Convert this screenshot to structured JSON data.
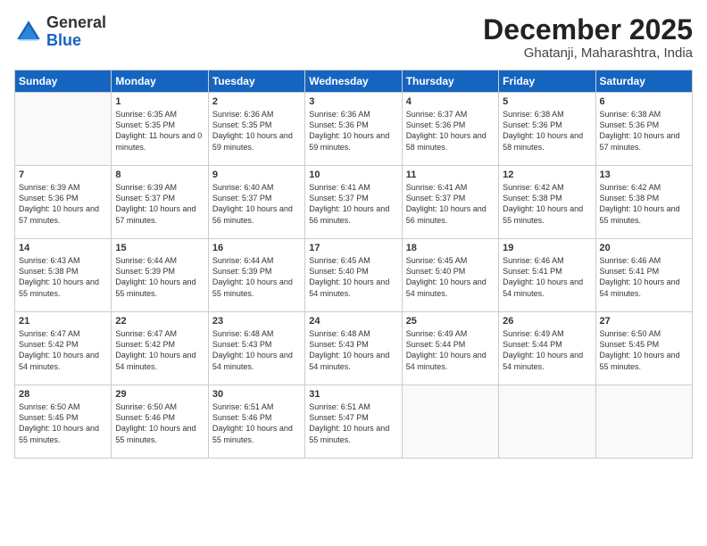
{
  "header": {
    "logo_line1": "General",
    "logo_line2": "Blue",
    "month": "December 2025",
    "location": "Ghatanji, Maharashtra, India"
  },
  "weekdays": [
    "Sunday",
    "Monday",
    "Tuesday",
    "Wednesday",
    "Thursday",
    "Friday",
    "Saturday"
  ],
  "weeks": [
    [
      {
        "day": "",
        "sunrise": "",
        "sunset": "",
        "daylight": ""
      },
      {
        "day": "1",
        "sunrise": "Sunrise: 6:35 AM",
        "sunset": "Sunset: 5:35 PM",
        "daylight": "Daylight: 11 hours and 0 minutes."
      },
      {
        "day": "2",
        "sunrise": "Sunrise: 6:36 AM",
        "sunset": "Sunset: 5:35 PM",
        "daylight": "Daylight: 10 hours and 59 minutes."
      },
      {
        "day": "3",
        "sunrise": "Sunrise: 6:36 AM",
        "sunset": "Sunset: 5:36 PM",
        "daylight": "Daylight: 10 hours and 59 minutes."
      },
      {
        "day": "4",
        "sunrise": "Sunrise: 6:37 AM",
        "sunset": "Sunset: 5:36 PM",
        "daylight": "Daylight: 10 hours and 58 minutes."
      },
      {
        "day": "5",
        "sunrise": "Sunrise: 6:38 AM",
        "sunset": "Sunset: 5:36 PM",
        "daylight": "Daylight: 10 hours and 58 minutes."
      },
      {
        "day": "6",
        "sunrise": "Sunrise: 6:38 AM",
        "sunset": "Sunset: 5:36 PM",
        "daylight": "Daylight: 10 hours and 57 minutes."
      }
    ],
    [
      {
        "day": "7",
        "sunrise": "Sunrise: 6:39 AM",
        "sunset": "Sunset: 5:36 PM",
        "daylight": "Daylight: 10 hours and 57 minutes."
      },
      {
        "day": "8",
        "sunrise": "Sunrise: 6:39 AM",
        "sunset": "Sunset: 5:37 PM",
        "daylight": "Daylight: 10 hours and 57 minutes."
      },
      {
        "day": "9",
        "sunrise": "Sunrise: 6:40 AM",
        "sunset": "Sunset: 5:37 PM",
        "daylight": "Daylight: 10 hours and 56 minutes."
      },
      {
        "day": "10",
        "sunrise": "Sunrise: 6:41 AM",
        "sunset": "Sunset: 5:37 PM",
        "daylight": "Daylight: 10 hours and 56 minutes."
      },
      {
        "day": "11",
        "sunrise": "Sunrise: 6:41 AM",
        "sunset": "Sunset: 5:37 PM",
        "daylight": "Daylight: 10 hours and 56 minutes."
      },
      {
        "day": "12",
        "sunrise": "Sunrise: 6:42 AM",
        "sunset": "Sunset: 5:38 PM",
        "daylight": "Daylight: 10 hours and 55 minutes."
      },
      {
        "day": "13",
        "sunrise": "Sunrise: 6:42 AM",
        "sunset": "Sunset: 5:38 PM",
        "daylight": "Daylight: 10 hours and 55 minutes."
      }
    ],
    [
      {
        "day": "14",
        "sunrise": "Sunrise: 6:43 AM",
        "sunset": "Sunset: 5:38 PM",
        "daylight": "Daylight: 10 hours and 55 minutes."
      },
      {
        "day": "15",
        "sunrise": "Sunrise: 6:44 AM",
        "sunset": "Sunset: 5:39 PM",
        "daylight": "Daylight: 10 hours and 55 minutes."
      },
      {
        "day": "16",
        "sunrise": "Sunrise: 6:44 AM",
        "sunset": "Sunset: 5:39 PM",
        "daylight": "Daylight: 10 hours and 55 minutes."
      },
      {
        "day": "17",
        "sunrise": "Sunrise: 6:45 AM",
        "sunset": "Sunset: 5:40 PM",
        "daylight": "Daylight: 10 hours and 54 minutes."
      },
      {
        "day": "18",
        "sunrise": "Sunrise: 6:45 AM",
        "sunset": "Sunset: 5:40 PM",
        "daylight": "Daylight: 10 hours and 54 minutes."
      },
      {
        "day": "19",
        "sunrise": "Sunrise: 6:46 AM",
        "sunset": "Sunset: 5:41 PM",
        "daylight": "Daylight: 10 hours and 54 minutes."
      },
      {
        "day": "20",
        "sunrise": "Sunrise: 6:46 AM",
        "sunset": "Sunset: 5:41 PM",
        "daylight": "Daylight: 10 hours and 54 minutes."
      }
    ],
    [
      {
        "day": "21",
        "sunrise": "Sunrise: 6:47 AM",
        "sunset": "Sunset: 5:42 PM",
        "daylight": "Daylight: 10 hours and 54 minutes."
      },
      {
        "day": "22",
        "sunrise": "Sunrise: 6:47 AM",
        "sunset": "Sunset: 5:42 PM",
        "daylight": "Daylight: 10 hours and 54 minutes."
      },
      {
        "day": "23",
        "sunrise": "Sunrise: 6:48 AM",
        "sunset": "Sunset: 5:43 PM",
        "daylight": "Daylight: 10 hours and 54 minutes."
      },
      {
        "day": "24",
        "sunrise": "Sunrise: 6:48 AM",
        "sunset": "Sunset: 5:43 PM",
        "daylight": "Daylight: 10 hours and 54 minutes."
      },
      {
        "day": "25",
        "sunrise": "Sunrise: 6:49 AM",
        "sunset": "Sunset: 5:44 PM",
        "daylight": "Daylight: 10 hours and 54 minutes."
      },
      {
        "day": "26",
        "sunrise": "Sunrise: 6:49 AM",
        "sunset": "Sunset: 5:44 PM",
        "daylight": "Daylight: 10 hours and 54 minutes."
      },
      {
        "day": "27",
        "sunrise": "Sunrise: 6:50 AM",
        "sunset": "Sunset: 5:45 PM",
        "daylight": "Daylight: 10 hours and 55 minutes."
      }
    ],
    [
      {
        "day": "28",
        "sunrise": "Sunrise: 6:50 AM",
        "sunset": "Sunset: 5:45 PM",
        "daylight": "Daylight: 10 hours and 55 minutes."
      },
      {
        "day": "29",
        "sunrise": "Sunrise: 6:50 AM",
        "sunset": "Sunset: 5:46 PM",
        "daylight": "Daylight: 10 hours and 55 minutes."
      },
      {
        "day": "30",
        "sunrise": "Sunrise: 6:51 AM",
        "sunset": "Sunset: 5:46 PM",
        "daylight": "Daylight: 10 hours and 55 minutes."
      },
      {
        "day": "31",
        "sunrise": "Sunrise: 6:51 AM",
        "sunset": "Sunset: 5:47 PM",
        "daylight": "Daylight: 10 hours and 55 minutes."
      },
      {
        "day": "",
        "sunrise": "",
        "sunset": "",
        "daylight": ""
      },
      {
        "day": "",
        "sunrise": "",
        "sunset": "",
        "daylight": ""
      },
      {
        "day": "",
        "sunrise": "",
        "sunset": "",
        "daylight": ""
      }
    ]
  ]
}
